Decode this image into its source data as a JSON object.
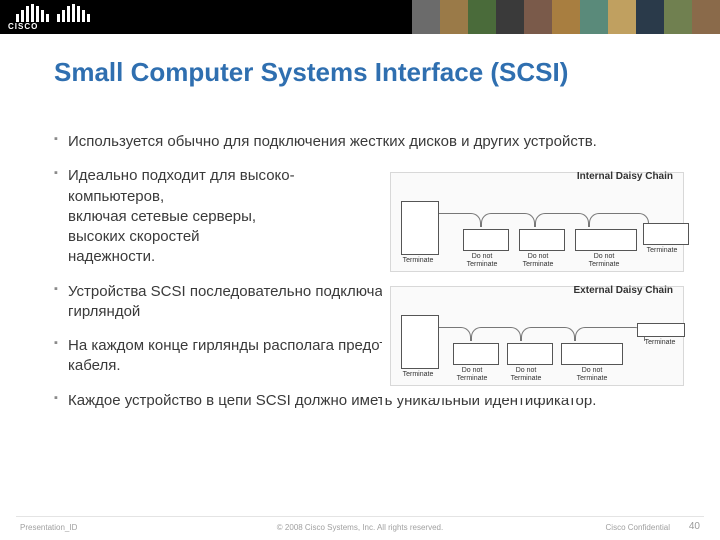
{
  "header": {
    "brand": "CISCO"
  },
  "title": "Small Computer Systems Interface (SCSI)",
  "bullets": [
    "Используется обычно для подключения жестких дисков и других устройств.",
    "Идеально подходит для высоко-\nкомпьютеров,\nвключая  сетевые    серверы,\nвысоких скоростей\nнадежности.",
    "Устройства SCSI последовательно подключаются друг к другу, образуя называемую гирляндой",
    "На каждом конце гирлянды располага предотвращения переотражения от концов кабеля.",
    "Каждое устройство в цепи SCSI должно иметь уникальный идентификатор."
  ],
  "diagram": {
    "top_label": "Internal Daisy Chain",
    "bottom_label": "External Daisy Chain",
    "terminate": "Terminate",
    "do_not_terminate": "Do not\nTerminate"
  },
  "footer": {
    "pres_id": "Presentation_ID",
    "copyright": "© 2008 Cisco Systems, Inc. All rights reserved.",
    "confidential": "Cisco Confidential",
    "page": "40"
  }
}
